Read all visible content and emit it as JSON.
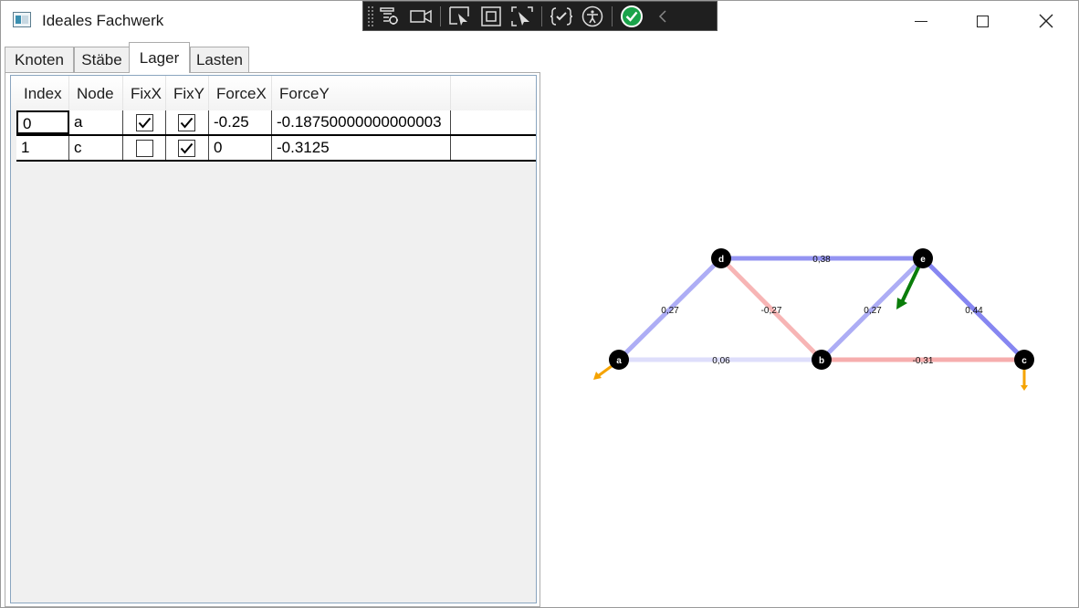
{
  "window": {
    "title": "Ideales Fachwerk"
  },
  "tabs": [
    "Knoten",
    "Stäbe",
    "Lager",
    "Lasten"
  ],
  "active_tab": "Lager",
  "grid": {
    "columns": [
      "Index",
      "Node",
      "FixX",
      "FixY",
      "ForceX",
      "ForceY"
    ],
    "rows": [
      {
        "index": "0",
        "node": "a",
        "fixx": true,
        "fixy": true,
        "forcex": "-0.25",
        "forcey": "-0.18750000000000003"
      },
      {
        "index": "1",
        "node": "c",
        "fixx": false,
        "fixy": true,
        "forcex": "0",
        "forcey": "-0.3125"
      }
    ]
  },
  "truss": {
    "nodes": {
      "a": "a",
      "b": "b",
      "c": "c",
      "d": "d",
      "e": "e"
    },
    "members": [
      {
        "from": "a",
        "to": "d",
        "label": "0,27",
        "value": 0.27
      },
      {
        "from": "d",
        "to": "b",
        "label": "-0,27",
        "value": -0.27
      },
      {
        "from": "d",
        "to": "e",
        "label": "0,38",
        "value": 0.38
      },
      {
        "from": "b",
        "to": "e",
        "label": "0,27",
        "value": 0.27
      },
      {
        "from": "e",
        "to": "c",
        "label": "0,44",
        "value": 0.44
      },
      {
        "from": "a",
        "to": "b",
        "label": "0,06",
        "value": 0.06
      },
      {
        "from": "b",
        "to": "c",
        "label": "-0,31",
        "value": -0.31
      }
    ],
    "colors": {
      "tension": "#7f7ff0",
      "compression": "#f28b8b",
      "reaction": "#f5a300",
      "load": "#0a7d0a",
      "node": "#000000"
    }
  }
}
